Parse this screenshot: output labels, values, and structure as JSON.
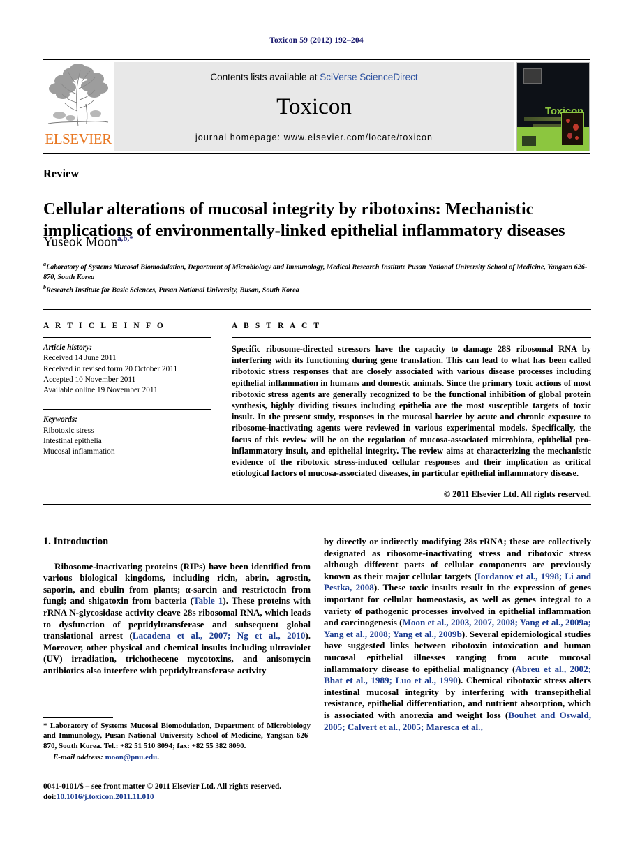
{
  "running_head": "Toxicon 59 (2012) 192–204",
  "masthead": {
    "publisher_name": "ELSEVIER",
    "contents_prefix": "Contents lists available at ",
    "contents_link": "SciVerse ScienceDirect",
    "journal_name": "Toxicon",
    "homepage_prefix": "journal homepage: ",
    "homepage_url": "www.elsevier.com/locate/toxicon",
    "cover_title": "Toxicon",
    "link_color": "#2b4f9e",
    "cover_accent": "#8CC63F",
    "elsevier_orange": "#E87722"
  },
  "article": {
    "type": "Review",
    "title": "Cellular alterations of mucosal integrity by ribotoxins: Mechanistic implications of environmentally-linked epithelial inflammatory diseases",
    "author": "Yuseok Moon",
    "author_marks": "a,b,*",
    "affiliation_a_mark": "a",
    "affiliation_a": "Laboratory of Systems Mucosal Biomodulation, Department of Microbiology and Immunology, Medical Research Institute Pusan National University School of Medicine, Yangsan 626-870, South Korea",
    "affiliation_b_mark": "b",
    "affiliation_b": "Research Institute for Basic Sciences, Pusan National University, Busan, South Korea"
  },
  "article_info": {
    "heading": "A R T I C L E  I N F O",
    "history_label": "Article history:",
    "history": [
      "Received 14 June 2011",
      "Received in revised form 20 October 2011",
      "Accepted 10 November 2011",
      "Available online 19 November 2011"
    ],
    "keywords_label": "Keywords:",
    "keywords": [
      "Ribotoxic stress",
      "Intestinal epithelia",
      "Mucosal inflammation"
    ]
  },
  "abstract": {
    "heading": "A B S T R A C T",
    "text": "Specific ribosome-directed stressors have the capacity to damage 28S ribosomal RNA by interfering with its functioning during gene translation. This can lead to what has been called ribotoxic stress responses that are closely associated with various disease processes including epithelial inflammation in humans and domestic animals. Since the primary toxic actions of most ribotoxic stress agents are generally recognized to be the functional inhibition of global protein synthesis, highly dividing tissues including epithelia are the most susceptible targets of toxic insult. In the present study, responses in the mucosal barrier by acute and chronic exposure to ribosome-inactivating agents were reviewed in various experimental models. Specifically, the focus of this review will be on the regulation of mucosa-associated microbiota, epithelial pro-inflammatory insult, and epithelial integrity. The review aims at characterizing the mechanistic evidence of the ribotoxic stress-induced cellular responses and their implication as critical etiological factors of mucosa-associated diseases, in particular epithelial inflammatory disease.",
    "copyright": "© 2011 Elsevier Ltd. All rights reserved."
  },
  "introduction": {
    "section_title": "1. Introduction",
    "left_paragraph": {
      "part1": "Ribosome-inactivating proteins (RIPs) have been identified from various biological kingdoms, including ricin, abrin, agrostin, saporin, and ebulin from plants; α-sarcin and restrictocin from fungi; and shigatoxin from bacteria (",
      "cite1": "Table 1",
      "part2": "). These proteins with rRNA N-glycosidase activity cleave 28s ribosomal RNA, which leads to dysfunction of peptidyltransferase and subsequent global translational arrest (",
      "cite2": "Lacadena et al., 2007; Ng et al., 2010",
      "part3": "). Moreover, other physical and chemical insults including ultraviolet (UV) irradiation, trichothecene mycotoxins, and anisomycin antibiotics also interfere with peptidyltransferase activity"
    },
    "right_paragraph": {
      "part1": "by directly or indirectly modifying 28s rRNA; these are collectively designated as ribosome-inactivating stress and ribotoxic stress although different parts of cellular components are previously known as their major cellular targets (",
      "cite1": "Iordanov et al., 1998; Li and Pestka, 2008",
      "part2": "). These toxic insults result in the expression of genes important for cellular homeostasis, as well as genes integral to a variety of pathogenic processes involved in epithelial inflammation and carcinogenesis (",
      "cite2": "Moon et al., 2003, 2007, 2008; Yang et al., 2009a; Yang et al., 2008; Yang et al., 2009b",
      "part3": "). Several epidemiological studies have suggested links between ribotoxin intoxication and human mucosal epithelial illnesses ranging from acute mucosal inflammatory disease to epithelial malignancy (",
      "cite3": "Abreu et al., 2002; Bhat et al., 1989; Luo et al., 1990",
      "part4": "). Chemical ribotoxic stress alters intestinal mucosal integrity by interfering with transepithelial resistance, epithelial differentiation, and nutrient absorption, which is associated with anorexia and weight loss (",
      "cite4": "Bouhet and Oswald, 2005; Calvert et al., 2005; Maresca et al.,"
    }
  },
  "footnote": {
    "marker_text": "* Laboratory of Systems Mucosal Biomodulation, Department of Microbiology and Immunology, Pusan National University School of Medicine, Yangsan 626-870, South Korea. Tel.: +82 51 510 8094; fax: +82 55 382 8090.",
    "email_label": "E-mail address:",
    "email": "moon@pnu.edu",
    "email_suffix": "."
  },
  "imprint": {
    "issn_line": "0041-0101/$ – see front matter © 2011 Elsevier Ltd. All rights reserved.",
    "doi_label": "doi:",
    "doi": "10.1016/j.toxicon.2011.11.010"
  }
}
